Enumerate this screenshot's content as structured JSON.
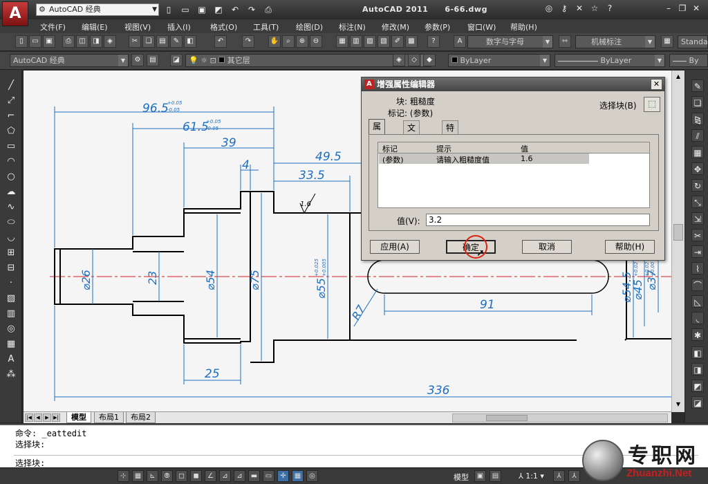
{
  "titlebar": {
    "logo_glyph": "A",
    "workspace": "AutoCAD 经典",
    "app_name": "AutoCAD 2011",
    "file_name": "6-66.dwg"
  },
  "menu": [
    "文件(F)",
    "编辑(E)",
    "视图(V)",
    "插入(I)",
    "格式(O)",
    "工具(T)",
    "绘图(D)",
    "标注(N)",
    "修改(M)",
    "参数(P)",
    "窗口(W)",
    "帮助(H)"
  ],
  "toolbar": {
    "text_style": "数字与字母",
    "dim_style": "机械标注",
    "table_style": "Standa",
    "workspace": "AutoCAD 经典",
    "layer": "其它层",
    "color": "ByLayer",
    "linetype": "ByLayer",
    "lineweight": "By"
  },
  "drawing": {
    "dims": [
      "96.5",
      "61.5",
      "39",
      "4",
      "49.5",
      "33.5",
      "1.6",
      "⌀26",
      "23",
      "⌀54",
      "⌀75",
      "⌀55",
      "R7",
      "91",
      "⌀54.5",
      "⌀45",
      "⌀37",
      "25",
      "336"
    ],
    "tol_965_upper": "+0.05",
    "tol_965_lower": "-0.05",
    "tol_615_upper": "+0.05",
    "tol_615_lower": "-0.05",
    "tol_55_upper": "+0.025",
    "tol_55_lower": "+0.005",
    "tol_545_upper": "+0.02",
    "tol_45_upper": "+0.02",
    "tol_45_lower": "+0.00"
  },
  "layout_tabs": [
    "模型",
    "布局1",
    "布局2"
  ],
  "command": {
    "line1": "命令: _eattedit",
    "line2": "选择块:",
    "line3": "选择块:"
  },
  "status": {
    "model": "模型",
    "scale": "1:1"
  },
  "watermark": {
    "text": "专职网",
    "url": "Zhuanzhi.Net"
  },
  "dialog": {
    "title": "增强属性编辑器",
    "block_label": "块: 粗糙度",
    "tag_label": "标记: (参数)",
    "select_block": "选择块(B)",
    "tabs": [
      "属性",
      "文字选项",
      "特性"
    ],
    "columns": [
      "标记",
      "提示",
      "值"
    ],
    "rows": [
      {
        "tag": "(参数)",
        "prompt": "请输入粗糙度值",
        "value": "1.6"
      }
    ],
    "value_label": "值(V):",
    "value": "3.2",
    "buttons": {
      "apply": "应用(A)",
      "ok": "确定",
      "cancel": "取消",
      "help": "帮助(H)"
    }
  },
  "colors": {
    "dimension": "#1f6fbf",
    "centerline": "#d42020",
    "outline": "#000000",
    "canvas": "#f5f5f5"
  }
}
